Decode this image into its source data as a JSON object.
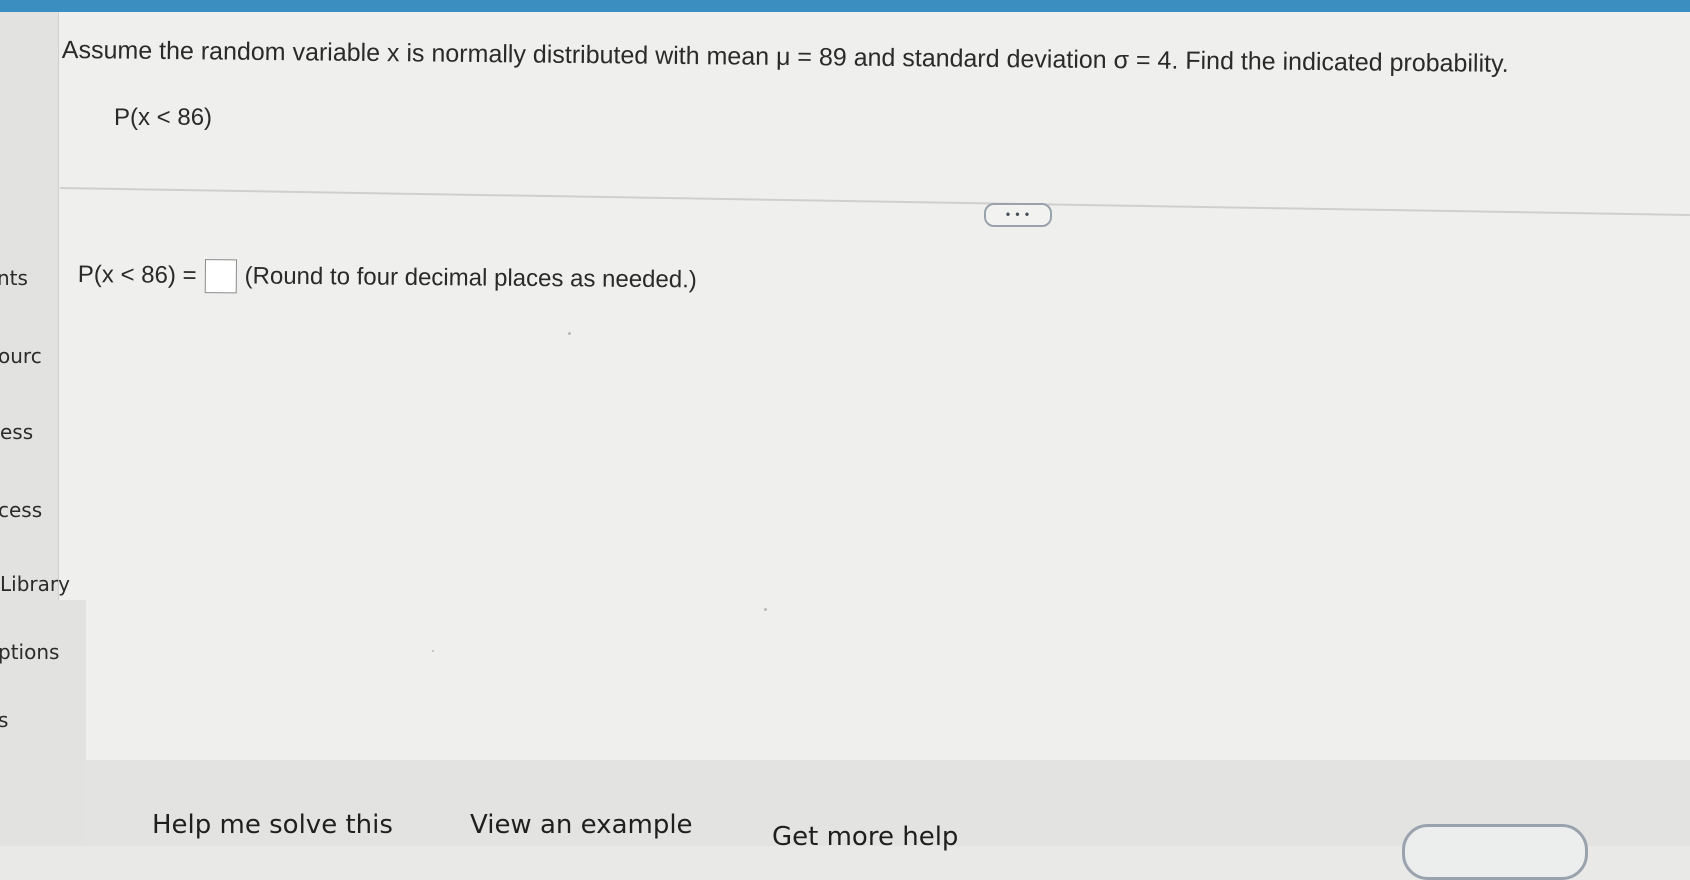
{
  "question": {
    "prompt": "Assume the random variable x is normally distributed with mean μ = 89 and standard deviation σ = 4. Find the indicated probability.",
    "expression": "P(x < 86)"
  },
  "toolbar": {
    "more_label": "• • •"
  },
  "answer": {
    "label": "P(x < 86) =",
    "hint": "(Round to four decimal places as needed.)"
  },
  "sidebar": {
    "items": [
      {
        "label": "nts"
      },
      {
        "label": "ourc"
      },
      {
        "label": "ess"
      },
      {
        "label": "cess"
      },
      {
        "label": "Library"
      },
      {
        "label": "ptions"
      },
      {
        "label": "s"
      }
    ]
  },
  "footer": {
    "help_label": "Help me solve this",
    "example_label": "View an example",
    "more_help_label": "Get more help"
  },
  "colors": {
    "accent_bar": "#3b8fc0",
    "page_background": "#eff0ed"
  }
}
